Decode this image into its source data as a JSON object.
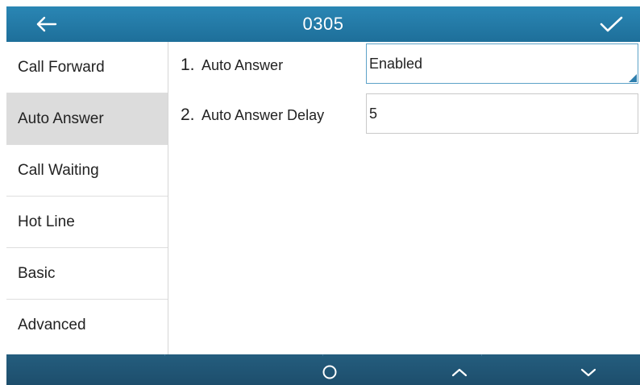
{
  "header": {
    "title": "0305",
    "back_icon": "arrow-left-icon",
    "confirm_icon": "checkmark-icon",
    "colors": {
      "bar": "#2a86b4",
      "text": "#ffffff"
    }
  },
  "sidebar": {
    "active_index": 1,
    "items": [
      {
        "label": "Call Forward"
      },
      {
        "label": "Auto Answer"
      },
      {
        "label": "Call Waiting"
      },
      {
        "label": "Hot Line"
      },
      {
        "label": "Basic"
      },
      {
        "label": "Advanced"
      }
    ]
  },
  "main": {
    "rows": [
      {
        "number": "1.",
        "label": "Auto Answer",
        "value": "Enabled",
        "control": "dropdown"
      },
      {
        "number": "2.",
        "label": "Auto Answer Delay",
        "value": "5",
        "control": "text"
      }
    ]
  },
  "softkeys": {
    "items": [
      {
        "icon": "circle-icon"
      },
      {
        "icon": "chevron-up-icon"
      },
      {
        "icon": "chevron-down-icon"
      }
    ],
    "colors": {
      "bar": "#1d4e6c"
    }
  }
}
